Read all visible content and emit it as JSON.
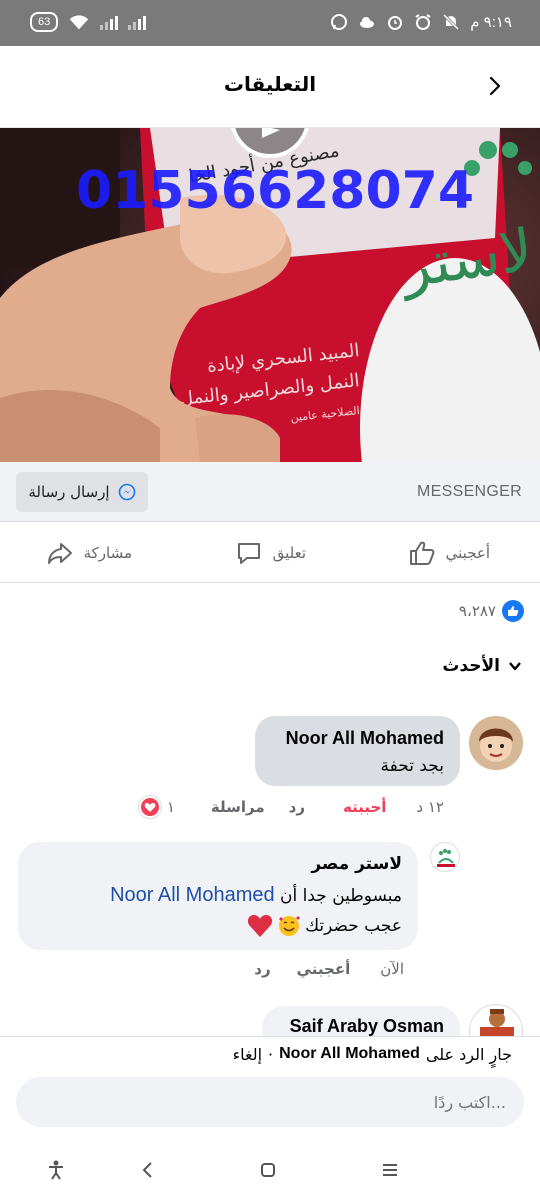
{
  "status": {
    "battery": "63",
    "time": "٩:١٩ م"
  },
  "header": {
    "title": "التعليقات"
  },
  "video": {
    "overlay_phone": "01556628074",
    "product_text_1": "مصنوع من أجود الخا",
    "product_text_2": "المبيد السحري لإبادة",
    "product_text_3": "النمل والصراصير والنمل ال",
    "product_text_4": "الصلاحية عامين",
    "brand_text": "لاستر"
  },
  "messenger": {
    "label": "MESSENGER",
    "send_button": "إرسال رسالة"
  },
  "actions": {
    "like": "أعجبني",
    "comment": "تعليق",
    "share": "مشاركة"
  },
  "reactions": {
    "count": "٩،٢٨٧"
  },
  "sort": {
    "label": "الأحدث"
  },
  "comments": [
    {
      "name": "Noor All Mohamed",
      "text": "بجد تحفة",
      "time": "١٢ د",
      "liked_label": "أحببته",
      "reply_label": "رد",
      "message_label": "مراسلة",
      "reaction_count": "١"
    },
    {
      "name": "لاستر مصر",
      "text_prefix": "مبسوطين جدا أن",
      "mention": "Noor All Mohamed",
      "text_suffix": "عجب حضرتك",
      "time": "الآن",
      "like_label": "أعجبني",
      "reply_label": "رد"
    },
    {
      "name": "Saif Araby Osman"
    }
  ],
  "reply": {
    "replying_prefix": "جارٍ الرد على",
    "replying_name": "Noor All Mohamed",
    "separator": "·",
    "cancel": "إلغاء",
    "placeholder": "اكتب ردًا..."
  },
  "colors": {
    "accent": "#1877f2",
    "love": "#f33e58",
    "bubble": "#f0f2f5",
    "selected_bubble": "#dadde1"
  }
}
